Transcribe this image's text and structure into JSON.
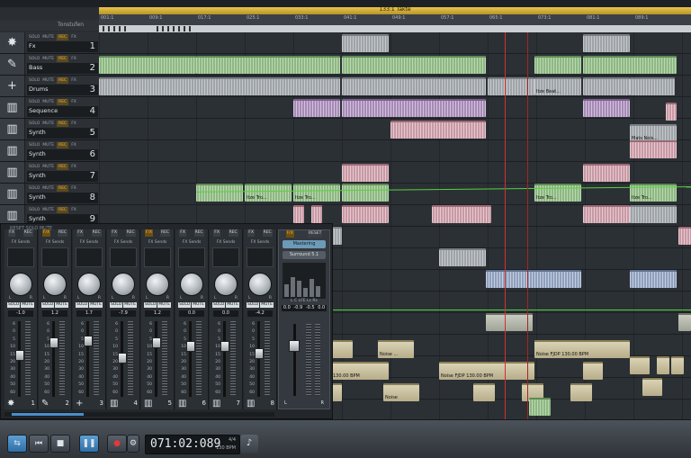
{
  "ruler": {
    "takte_label": "133:1 Takte",
    "marks": [
      "001:1",
      "009:1",
      "017:1",
      "025:1",
      "033:1",
      "041:1",
      "049:1",
      "057:1",
      "065:1",
      "073:1",
      "081:1",
      "089:1"
    ],
    "tonstufen_label": "Tonstufen"
  },
  "tracks": [
    {
      "name": "Fx",
      "num": "1",
      "icon": "splash-icon",
      "glyph": "✸",
      "solo": "SOLO",
      "mute": "MUTE",
      "rec": "REC",
      "fx": "FX"
    },
    {
      "name": "Bass",
      "num": "2",
      "icon": "guitar-icon",
      "glyph": "✎",
      "solo": "SOLO",
      "mute": "MUTE",
      "rec": "REC",
      "fx": "FX"
    },
    {
      "name": "Drums",
      "num": "3",
      "icon": "plus-icon",
      "glyph": "+",
      "solo": "SOLO",
      "mute": "MUTE",
      "rec": "REC",
      "fx": "FX"
    },
    {
      "name": "Sequence",
      "num": "4",
      "icon": "keyboard-icon",
      "glyph": "▥",
      "solo": "SOLO",
      "mute": "MUTE",
      "rec": "REC",
      "fx": "FX"
    },
    {
      "name": "Synth",
      "num": "5",
      "icon": "keyboard-icon",
      "glyph": "▥",
      "solo": "SOLO",
      "mute": "MUTE",
      "rec": "REC",
      "fx": "FX"
    },
    {
      "name": "Synth",
      "num": "6",
      "icon": "keyboard-icon",
      "glyph": "▥",
      "solo": "SOLO",
      "mute": "MUTE",
      "rec": "REC",
      "fx": "FX"
    },
    {
      "name": "Synth",
      "num": "7",
      "icon": "keyboard-icon",
      "glyph": "▥",
      "solo": "SOLO",
      "mute": "MUTE",
      "rec": "REC",
      "fx": "FX"
    },
    {
      "name": "Synth",
      "num": "8",
      "icon": "keyboard-icon",
      "glyph": "▥",
      "solo": "SOLO",
      "mute": "MUTE",
      "rec": "REC",
      "fx": "FX"
    },
    {
      "name": "Synth",
      "num": "9",
      "icon": "keyboard-icon",
      "glyph": "▥",
      "solo": "SOLO",
      "mute": "MUTE",
      "rec": "REC",
      "fx": "FX"
    }
  ],
  "clip_labels": {
    "itze_beat": "Itze Beat...",
    "itze_tro": "Itze Tro...",
    "mats_nois": "Mats Nois...",
    "noise": "Noise ...",
    "noise_fjdp": "Noise FJDP 130.00 BPM",
    "bpm130": "130.00 BPM",
    "noise_short": "Noise"
  },
  "mixer": {
    "fx_label": "FX",
    "rec_label": "REC",
    "fxo_label": "F/X",
    "sends_label": "FX Sends",
    "solo": "SOLO",
    "mute": "MUTE",
    "l": "L",
    "r": "R",
    "scale": [
      "6",
      "0",
      "5",
      "10",
      "15",
      "20",
      "30",
      "40",
      "50",
      "60"
    ],
    "channels": [
      {
        "num": "1",
        "vol": "-1.0",
        "icon": "splash-icon",
        "glyph": "✸",
        "level": 0.45
      },
      {
        "num": "2",
        "vol": "1.2",
        "icon": "guitar-icon",
        "glyph": "✎",
        "level": 0.25
      },
      {
        "num": "3",
        "vol": "1.7",
        "icon": "plus-icon",
        "glyph": "+",
        "level": 0.22
      },
      {
        "num": "4",
        "vol": "-7.9",
        "icon": "keyboard-icon",
        "glyph": "▥",
        "level": 0.48
      },
      {
        "num": "5",
        "vol": "1.2",
        "icon": "keyboard-icon",
        "glyph": "▥",
        "level": 0.25
      },
      {
        "num": "6",
        "vol": "0.0",
        "icon": "keyboard-icon",
        "glyph": "▥",
        "level": 0.3
      },
      {
        "num": "7",
        "vol": "0.0",
        "icon": "keyboard-icon",
        "glyph": "▥",
        "level": 0.3
      },
      {
        "num": "8",
        "vol": "-4.2",
        "icon": "keyboard-icon",
        "glyph": "▥",
        "level": 0.42
      }
    ],
    "master": {
      "reset": "RESET",
      "mastering": "Mastering",
      "surround": "Surround 5.1",
      "meter_label": "L C LFE Ls Rs",
      "vals": [
        "0.0",
        "-0.9",
        "-0.5",
        "0.0"
      ],
      "l": "L",
      "r": "R"
    }
  },
  "transport": {
    "time": "071:02:089",
    "signature": "4/4",
    "bpm": "130 BPM",
    "buttons": {
      "loop": "⇆",
      "rewind": "⏮",
      "stop": "■",
      "pause": "❚❚",
      "record": "●",
      "record_options": "⚙",
      "metronome": "♪"
    }
  },
  "status_line": "RESET  SOLO  MUTE"
}
